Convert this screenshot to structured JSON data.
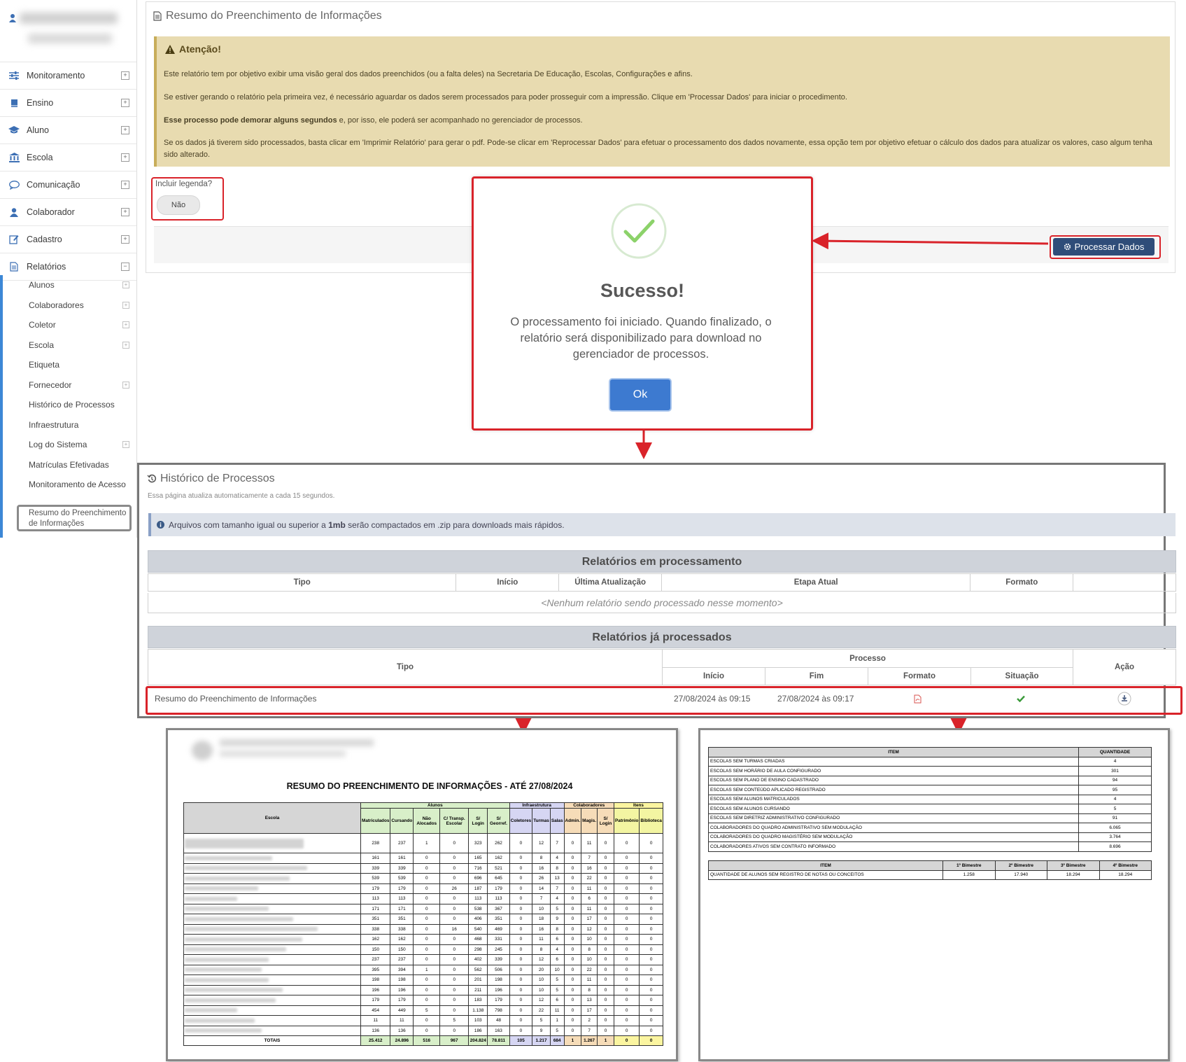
{
  "sidebar": {
    "items": [
      {
        "label": "Monitoramento",
        "icon": "sliders-icon"
      },
      {
        "label": "Ensino",
        "icon": "book-icon"
      },
      {
        "label": "Aluno",
        "icon": "graduation-cap-icon"
      },
      {
        "label": "Escola",
        "icon": "institution-icon"
      },
      {
        "label": "Comunicação",
        "icon": "chat-bubble-icon"
      },
      {
        "label": "Colaborador",
        "icon": "user-icon"
      },
      {
        "label": "Cadastro",
        "icon": "edit-icon"
      },
      {
        "label": "Relatórios",
        "icon": "file-text-icon"
      }
    ],
    "sub_items": [
      "Alunos",
      "Colaboradores",
      "Coletor",
      "Escola",
      "Etiqueta",
      "Fornecedor",
      "Histórico de Processos",
      "Infraestrutura",
      "Log do Sistema",
      "Matrículas Efetivadas",
      "Monitoramento de Acesso"
    ],
    "active_item": "Resumo do Preenchimento de Informações"
  },
  "main": {
    "title": "Resumo do Preenchimento de Informações",
    "alert": {
      "title": "Atenção!",
      "p1": "Este relatório tem por objetivo exibir uma visão geral dos dados preenchidos (ou a falta deles) na Secretaria De Educação, Escolas, Configurações e afins.",
      "p2": "Se estiver gerando o relatório pela primeira vez, é necessário aguardar os dados serem processados para poder prosseguir com a impressão. Clique em 'Processar Dados' para iniciar o procedimento.",
      "p3_bold": "Esse processo pode demorar alguns segundos",
      "p3_rest": " e, por isso, ele poderá ser acompanhado no gerenciador de processos.",
      "p4": "Se os dados já tiverem sido processados, basta clicar em 'Imprimir Relatório' para gerar o pdf. Pode-se clicar em 'Reprocessar Dados' para efetuar o processamento dos dados novamente, essa opção tem por objetivo efetuar o cálculo dos dados para atualizar os valores, caso algum tenha sido alterado."
    },
    "legend_label": "Incluir legenda?",
    "legend_toggle": "Não",
    "process_button": "Processar Dados"
  },
  "modal": {
    "title": "Sucesso!",
    "text": "O processamento foi iniciado. Quando finalizado, o relatório será disponibilizado para download no gerenciador de processos.",
    "ok": "Ok"
  },
  "history": {
    "title": "Histórico de Processos",
    "subtitle": "Essa página atualiza automaticamente a cada 15 segundos.",
    "info_pre": "Arquivos com tamanho igual ou superior a ",
    "info_bold": "1mb",
    "info_post": " serão compactados em .zip para downloads mais rápidos.",
    "processing": {
      "title": "Relatórios em processamento",
      "columns": [
        "Tipo",
        "Início",
        "Última Atualização",
        "Etapa Atual",
        "Formato",
        ""
      ],
      "empty": "<Nenhum relatório sendo processado nesse momento>"
    },
    "processed": {
      "title": "Relatórios já processados",
      "col_tipo": "Tipo",
      "col_processo": "Processo",
      "col_acao": "Ação",
      "sub_columns": [
        "Início",
        "Fim",
        "Formato",
        "Situação"
      ],
      "row": {
        "tipo": "Resumo do Preenchimento de Informações",
        "inicio": "27/08/2024 às 09:15",
        "fim": "27/08/2024 às 09:17"
      }
    }
  },
  "report1": {
    "title": "RESUMO DO PREENCHIMENTO DE INFORMAÇÕES - ATÉ 27/08/2024",
    "col_escola": "Escola",
    "groups": [
      "Alunos",
      "Infraestrutura",
      "Colaboradores",
      "Itens"
    ],
    "columns": [
      "Matriculados",
      "Cursando",
      "Não Alocados",
      "C/ Transp. Escolar",
      "S/ Login",
      "S/ Georref.",
      "Coletores",
      "Turmas",
      "Salas",
      "Admin.",
      "Magis.",
      "S/ Login",
      "Patrimônio",
      "Biblioteca"
    ],
    "rows": [
      [
        "238",
        "237",
        "1",
        "0",
        "323",
        "262",
        "0",
        "12",
        "7",
        "0",
        "11",
        "0",
        "0",
        "0"
      ],
      [
        "161",
        "161",
        "0",
        "0",
        "165",
        "162",
        "0",
        "8",
        "4",
        "0",
        "7",
        "0",
        "0",
        "0"
      ],
      [
        "339",
        "339",
        "0",
        "0",
        "716",
        "521",
        "0",
        "16",
        "8",
        "0",
        "16",
        "0",
        "0",
        "0"
      ],
      [
        "539",
        "539",
        "0",
        "0",
        "696",
        "645",
        "0",
        "26",
        "13",
        "0",
        "22",
        "0",
        "0",
        "0"
      ],
      [
        "179",
        "179",
        "0",
        "26",
        "187",
        "179",
        "0",
        "14",
        "7",
        "0",
        "11",
        "0",
        "0",
        "0"
      ],
      [
        "113",
        "113",
        "0",
        "0",
        "113",
        "113",
        "0",
        "7",
        "4",
        "0",
        "6",
        "0",
        "0",
        "0"
      ],
      [
        "171",
        "171",
        "0",
        "0",
        "538",
        "367",
        "0",
        "10",
        "5",
        "0",
        "11",
        "0",
        "0",
        "0"
      ],
      [
        "351",
        "351",
        "0",
        "0",
        "406",
        "351",
        "0",
        "18",
        "9",
        "0",
        "17",
        "0",
        "0",
        "0"
      ],
      [
        "338",
        "338",
        "0",
        "16",
        "540",
        "469",
        "0",
        "16",
        "8",
        "0",
        "12",
        "0",
        "0",
        "0"
      ],
      [
        "162",
        "162",
        "0",
        "0",
        "468",
        "331",
        "0",
        "11",
        "6",
        "0",
        "10",
        "0",
        "0",
        "0"
      ],
      [
        "150",
        "150",
        "0",
        "0",
        "298",
        "245",
        "0",
        "8",
        "4",
        "0",
        "8",
        "0",
        "0",
        "0"
      ],
      [
        "237",
        "237",
        "0",
        "0",
        "402",
        "339",
        "0",
        "12",
        "6",
        "0",
        "10",
        "0",
        "0",
        "0"
      ],
      [
        "395",
        "394",
        "1",
        "0",
        "562",
        "506",
        "0",
        "20",
        "10",
        "0",
        "22",
        "0",
        "0",
        "0"
      ],
      [
        "198",
        "198",
        "0",
        "0",
        "201",
        "198",
        "0",
        "10",
        "5",
        "0",
        "11",
        "0",
        "0",
        "0"
      ],
      [
        "196",
        "196",
        "0",
        "0",
        "211",
        "196",
        "0",
        "10",
        "5",
        "0",
        "8",
        "0",
        "0",
        "0"
      ],
      [
        "179",
        "179",
        "0",
        "0",
        "183",
        "179",
        "0",
        "12",
        "6",
        "0",
        "13",
        "0",
        "0",
        "0"
      ],
      [
        "454",
        "449",
        "5",
        "0",
        "1.138",
        "798",
        "0",
        "22",
        "11",
        "0",
        "17",
        "0",
        "0",
        "0"
      ],
      [
        "11",
        "11",
        "0",
        "5",
        "103",
        "48",
        "0",
        "5",
        "1",
        "0",
        "2",
        "0",
        "0",
        "0"
      ],
      [
        "136",
        "136",
        "0",
        "0",
        "186",
        "163",
        "0",
        "9",
        "5",
        "0",
        "7",
        "0",
        "0",
        "0"
      ]
    ],
    "totals_label": "TOTAIS",
    "totals": [
      "25.412",
      "24.896",
      "516",
      "967",
      "204.824",
      "78.811",
      "105",
      "1.217",
      "684",
      "1",
      "1.267",
      "1",
      "0",
      "0"
    ]
  },
  "report2": {
    "col_item": "ITEM",
    "col_qtd": "QUANTIDADE",
    "items": [
      {
        "item": "ESCOLAS SEM TURMAS CRIADAS",
        "qtd": "4"
      },
      {
        "item": "ESCOLAS SEM HORÁRIO DE AULA CONFIGURADO",
        "qtd": "301"
      },
      {
        "item": "ESCOLAS SEM PLANO DE ENSINO CADASTRADO",
        "qtd": "94"
      },
      {
        "item": "ESCOLAS SEM CONTEÚDO APLICADO REGISTRADO",
        "qtd": "95"
      },
      {
        "item": "ESCOLAS SEM ALUNOS MATRICULADOS",
        "qtd": "4"
      },
      {
        "item": "ESCOLAS SEM ALUNOS CURSANDO",
        "qtd": "5"
      },
      {
        "item": "ESCOLAS SEM DIRETRIZ ADMINISTRATIVO CONFIGURADO",
        "qtd": "91"
      },
      {
        "item": "COLABORADORES DO QUADRO ADMINISTRATIVO SEM MODULAÇÃO",
        "qtd": "6.065"
      },
      {
        "item": "COLABORADORES DO QUADRO MAGISTÉRIO SEM MODULAÇÃO",
        "qtd": "3.764"
      },
      {
        "item": "COLABORADORES ATIVOS SEM CONTRATO INFORMADO",
        "qtd": "8.696"
      }
    ],
    "bimestres": [
      "1º Bimestre",
      "2º Bimestre",
      "3º Bimestre",
      "4º Bimestre"
    ],
    "notes_item": "QUANTIDADE DE ALUNOS SEM REGISTRO DE NOTAS OU CONCEITOS",
    "notes_values": [
      "1.258",
      "17.940",
      "18.294",
      "18.294"
    ]
  },
  "colors": {
    "accent": "#3c87d6",
    "highlight": "#d9232a",
    "process_button": "#2f4d79",
    "alert_bg": "#e8dbb0",
    "ok_button": "#3d7ad0"
  }
}
